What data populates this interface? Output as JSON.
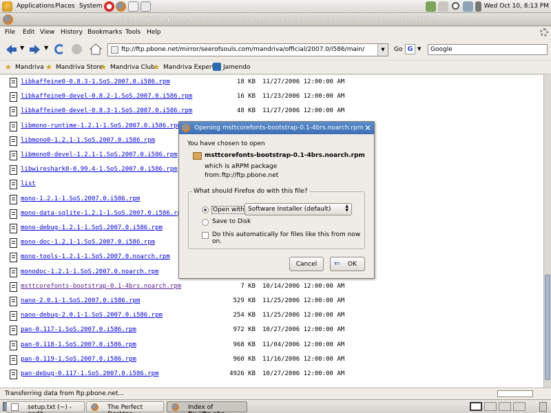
{
  "top_panel": {
    "menus": [
      "Applications",
      "Places",
      "System"
    ],
    "clock": "Wed Oct 10,  8:13 PM"
  },
  "window": {
    "title": "Index of ftp://ftp.pbone.net/mirror/seerofsouls.com/mandriva/official/2007.0/i586/main/ - Mozilla Firefox"
  },
  "menubar": [
    "File",
    "Edit",
    "View",
    "History",
    "Bookmarks",
    "Tools",
    "Help"
  ],
  "navbar": {
    "url": "ftp://ftp.pbone.net/mirror/seerofsouls.com/mandriva/official/2007.0/i586/main/",
    "go_label": "Go",
    "search_placeholder": "Google"
  },
  "bookmarks": [
    "Mandriva",
    "Mandriva Store",
    "Mandriva Club",
    "Mandriva Expert",
    "Jamendo"
  ],
  "files": [
    {
      "name": "libkaffeine0-0.8.3-1.SoS.2007.0.i586.rpm",
      "size": "18 KB",
      "date": "11/27/2006 12:00:00 AM"
    },
    {
      "name": "libkaffeine0-devel-0.8.2-1.SoS.2007.0.i586.rpm",
      "size": "16 KB",
      "date": "11/23/2006 12:00:00 AM"
    },
    {
      "name": "libkaffeine0-devel-0.8.3-1.SoS.2007.0.i586.rpm",
      "size": "48 KB",
      "date": "11/27/2006 12:00:00 AM"
    },
    {
      "name": "libmono-runtime-1.2.1-1.SoS.2007.0.i586.rpm",
      "size": "",
      "date": ""
    },
    {
      "name": "libmono0-1.2.1-1.SoS.2007.0.i586.rpm",
      "size": "",
      "date": ""
    },
    {
      "name": "libmono0-devel-1.2.1-1.SoS.2007.0.i586.rpm",
      "size": "",
      "date": ""
    },
    {
      "name": "libwireshark0-0.99.4-1.SoS.2007.0.i586.rpm",
      "size": "",
      "date": ""
    },
    {
      "name": "list",
      "size": "",
      "date": ""
    },
    {
      "name": "mono-1.2.1-1.SoS.2007.0.i586.rpm",
      "size": "",
      "date": ""
    },
    {
      "name": "mono-data-sqlite-1.2.1-1.SoS.2007.0.i586.rpm",
      "size": "",
      "date": ""
    },
    {
      "name": "mono-debug-1.2.1-1.SoS.2007.0.i586.rpm",
      "size": "",
      "date": ""
    },
    {
      "name": "mono-doc-1.2.1-1.SoS.2007.0.i586.rpm",
      "size": "",
      "date": ""
    },
    {
      "name": "mono-tools-1.2.1-1.SoS.2007.0.noarch.rpm",
      "size": "",
      "date": ""
    },
    {
      "name": "monodoc-1.2.1-1.SoS.2007.0.noarch.rpm",
      "size": "",
      "date": ""
    },
    {
      "name": "msttcorefonts-bootstrap-0.1-4brs.noarch.rpm",
      "size": "7 KB",
      "date": "10/14/2006 12:00:00 AM"
    },
    {
      "name": "nano-2.0.1-1.SoS.2007.0.i586.rpm",
      "size": "529 KB",
      "date": "11/25/2006 12:00:00 AM"
    },
    {
      "name": "nano-debug-2.0.1-1.SoS.2007.0.i586.rpm",
      "size": "254 KB",
      "date": "11/25/2006 12:00:00 AM"
    },
    {
      "name": "pan-0.117-1.SoS.2007.0.i586.rpm",
      "size": "972 KB",
      "date": "10/27/2006 12:00:00 AM"
    },
    {
      "name": "pan-0.118-1.SoS.2007.0.i586.rpm",
      "size": "968 KB",
      "date": "11/04/2006 12:00:00 AM"
    },
    {
      "name": "pan-0.119-1.SoS.2007.0.i586.rpm",
      "size": "960 KB",
      "date": "11/16/2006 12:00:00 AM"
    },
    {
      "name": "pan-debug-0.117-1.SoS.2007.0.i586.rpm",
      "size": "4926 KB",
      "date": "10/27/2006 12:00:00 AM"
    }
  ],
  "statusbar": {
    "text": "Transferring data from ftp.pbone.net..."
  },
  "taskbar": {
    "tasks": [
      "setup.txt (~) - gedit",
      "The Perfect Desktop...",
      "Index of ftp://ftp.pbo..."
    ]
  },
  "dialog": {
    "title": "Opening msttcorefonts-bootstrap-0.1-4brs.noarch.rpm",
    "intro": "You have chosen to open",
    "filename": "msttcorefonts-bootstrap-0.1-4brs.noarch.rpm",
    "which_is_label": "which is a:",
    "which_is_value": "RPM package",
    "from_label": "from:",
    "from_value": "ftp://ftp.pbone.net",
    "group_label": "What should Firefox do with this file?",
    "open_with_label": "Open with",
    "app_select": "Software Installer (default)",
    "save_label": "Save to Disk",
    "auto_label": "Do this automatically for files like this from now on.",
    "cancel": "Cancel",
    "ok": "OK"
  },
  "colors": {
    "link": "#0000d8",
    "dialog_title": "#3c6eb5",
    "panel": "#dcdad5"
  }
}
